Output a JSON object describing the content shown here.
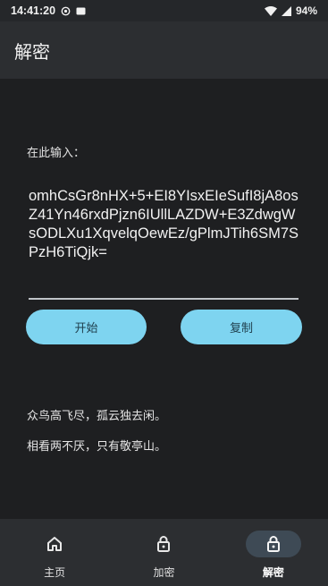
{
  "status_bar": {
    "time": "14:41:20",
    "battery": "94%"
  },
  "app_bar": {
    "title": "解密"
  },
  "main": {
    "input_label": "在此输入：",
    "input_value": "omhCsGr8nHX+5+EI8YIsxEIeSufI8jA8osZ41Yn46rxdPjzn6IUllLAZDW+E3ZdwgWsODLXu1XqvelqOewEz/gPlmJTih6SM7SPzH6TiQjk=",
    "start_button": "开始",
    "copy_button": "复制",
    "output_lines": [
      "众鸟高飞尽，孤云独去闲。",
      "相看两不厌，只有敬亭山。"
    ]
  },
  "bottom_nav": {
    "items": [
      {
        "label": "主页",
        "icon": "home-icon"
      },
      {
        "label": "加密",
        "icon": "lock-icon"
      },
      {
        "label": "解密",
        "icon": "lock-icon",
        "active": true
      }
    ]
  }
}
